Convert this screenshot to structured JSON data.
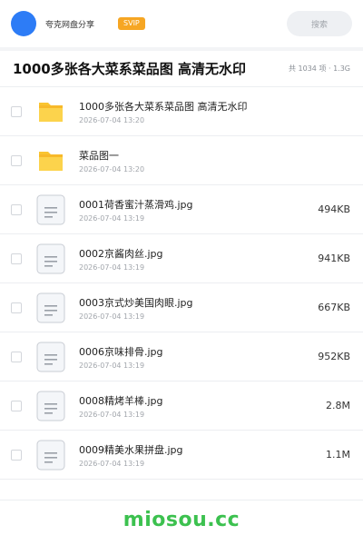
{
  "topbar": {
    "share_name": "夸克网盘分享",
    "badge": "SVIP",
    "search_label": "搜索",
    "avatar_color": "#2d7cf6"
  },
  "header": {
    "title": "1000多张各大菜系菜品图 高清无水印",
    "count": "共 1034 项 · 1.3G"
  },
  "items": [
    {
      "type": "folder",
      "icon": "folder-icon",
      "name": "1000多张各大菜系菜品图 高清无水印",
      "date": "2026-07-04 13:20",
      "size": ""
    },
    {
      "type": "folder",
      "icon": "folder-icon",
      "name": "菜品图一",
      "date": "2026-07-04 13:20",
      "size": ""
    },
    {
      "type": "file",
      "icon": "file-icon",
      "name": "0001荷香蜜汁蒸滑鸡.jpg",
      "date": "2026-07-04 13:19",
      "size": "494KB"
    },
    {
      "type": "file",
      "icon": "file-icon",
      "name": "0002京酱肉丝.jpg",
      "date": "2026-07-04 13:19",
      "size": "941KB"
    },
    {
      "type": "file",
      "icon": "file-icon",
      "name": "0003京式炒美国肉眼.jpg",
      "date": "2026-07-04 13:19",
      "size": "667KB"
    },
    {
      "type": "file",
      "icon": "file-icon",
      "name": "0006京味排骨.jpg",
      "date": "2026-07-04 13:19",
      "size": "952KB"
    },
    {
      "type": "file",
      "icon": "file-icon",
      "name": "0008精烤羊棒.jpg",
      "date": "2026-07-04 13:19",
      "size": "2.8M"
    },
    {
      "type": "file",
      "icon": "file-icon",
      "name": "0009精美水果拼盘.jpg",
      "date": "2026-07-04 13:19",
      "size": "1.1M"
    }
  ],
  "footer": {
    "brand": "miosou.cc",
    "brand_color": "#3cc14f"
  }
}
